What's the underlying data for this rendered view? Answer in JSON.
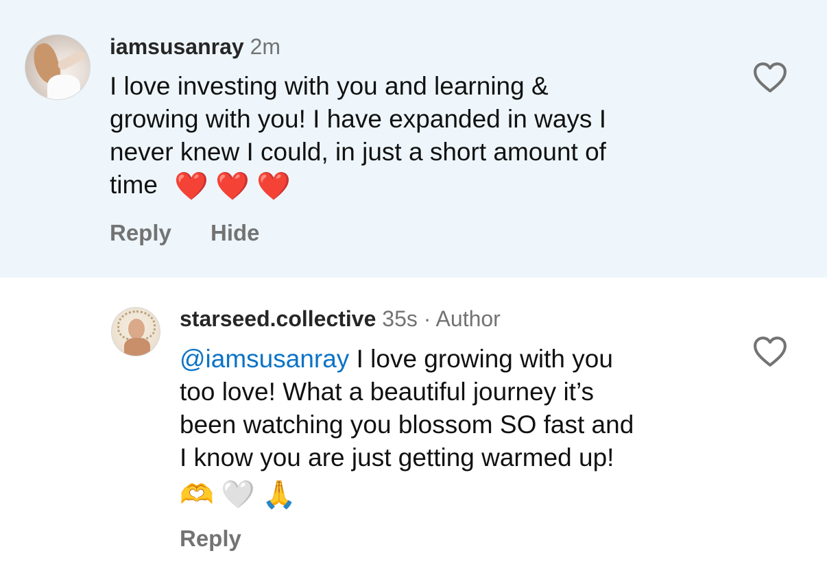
{
  "comments": [
    {
      "username": "iamsusanray",
      "time": "2m",
      "avatar_icon": "profile-photo",
      "text": "I love investing with you and learning &",
      "text_line2": "growing with you! I have expanded in ways I",
      "text_line3": "never knew I could, in just a short amount of",
      "text_line4": "time",
      "emojis": [
        "❤️",
        "❤️",
        "❤️"
      ],
      "actions": {
        "reply": "Reply",
        "hide": "Hide"
      },
      "like_icon": "heart-outline-icon",
      "background": "#eef6fb"
    }
  ],
  "reply": {
    "username": "starseed.collective",
    "time": "35s",
    "separator": " · ",
    "badge": "Author",
    "mention": "@iamsusanray",
    "text_line1": " I love growing with you",
    "text_line2": "too love! What a beautiful journey it’s",
    "text_line3": "been watching you blossom SO fast and",
    "text_line4": "I know you are just getting warmed up!",
    "emojis": [
      "🫶",
      "🤍",
      "🙏"
    ],
    "actions": {
      "reply": "Reply"
    },
    "like_icon": "heart-outline-icon",
    "mention_color": "#0b73c6"
  }
}
